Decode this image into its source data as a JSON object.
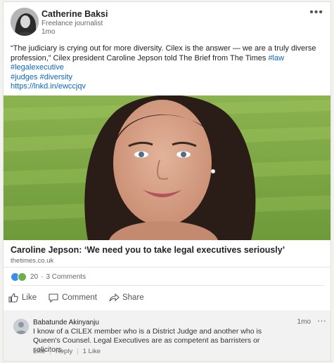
{
  "post": {
    "author_name": "Catherine Baksi",
    "author_title": "Freelance journalist",
    "time": "1mo",
    "more_label": "•••",
    "text_before": "“The judiciary is crying out for more diversity. Cilex is the answer — we are a truly diverse profession,” Cilex president Caroline Jepson told The Brief from The Times ",
    "hashtags_line1": "#law #legalexecutive",
    "hashtags_line2": "#judges #diversity",
    "link": "https://lnkd.in/ewccjqv"
  },
  "article": {
    "title": "Caroline Jepson: ‘We need you to take legal executives seriously’",
    "source": "thetimes.co.uk"
  },
  "social": {
    "reaction_count": "20",
    "separator": "·",
    "comments": "3 Comments"
  },
  "actions": {
    "like": "Like",
    "comment": "Comment",
    "share": "Share"
  },
  "comment": {
    "author": "Babatunde Akinyanju",
    "time": "1mo",
    "more_label": "···",
    "text": "I know of a CILEX member who is a District Judge and another who is Queen's Counsel. Legal Executives are as competent as barristers or solicitors.",
    "like_label": "Like",
    "reply_label": "Reply",
    "separator": "|",
    "likes": "1 Like"
  },
  "colors": {
    "link": "#0a66c2",
    "like_reaction": "#378fe9",
    "celebrate_reaction": "#6dae4f"
  }
}
